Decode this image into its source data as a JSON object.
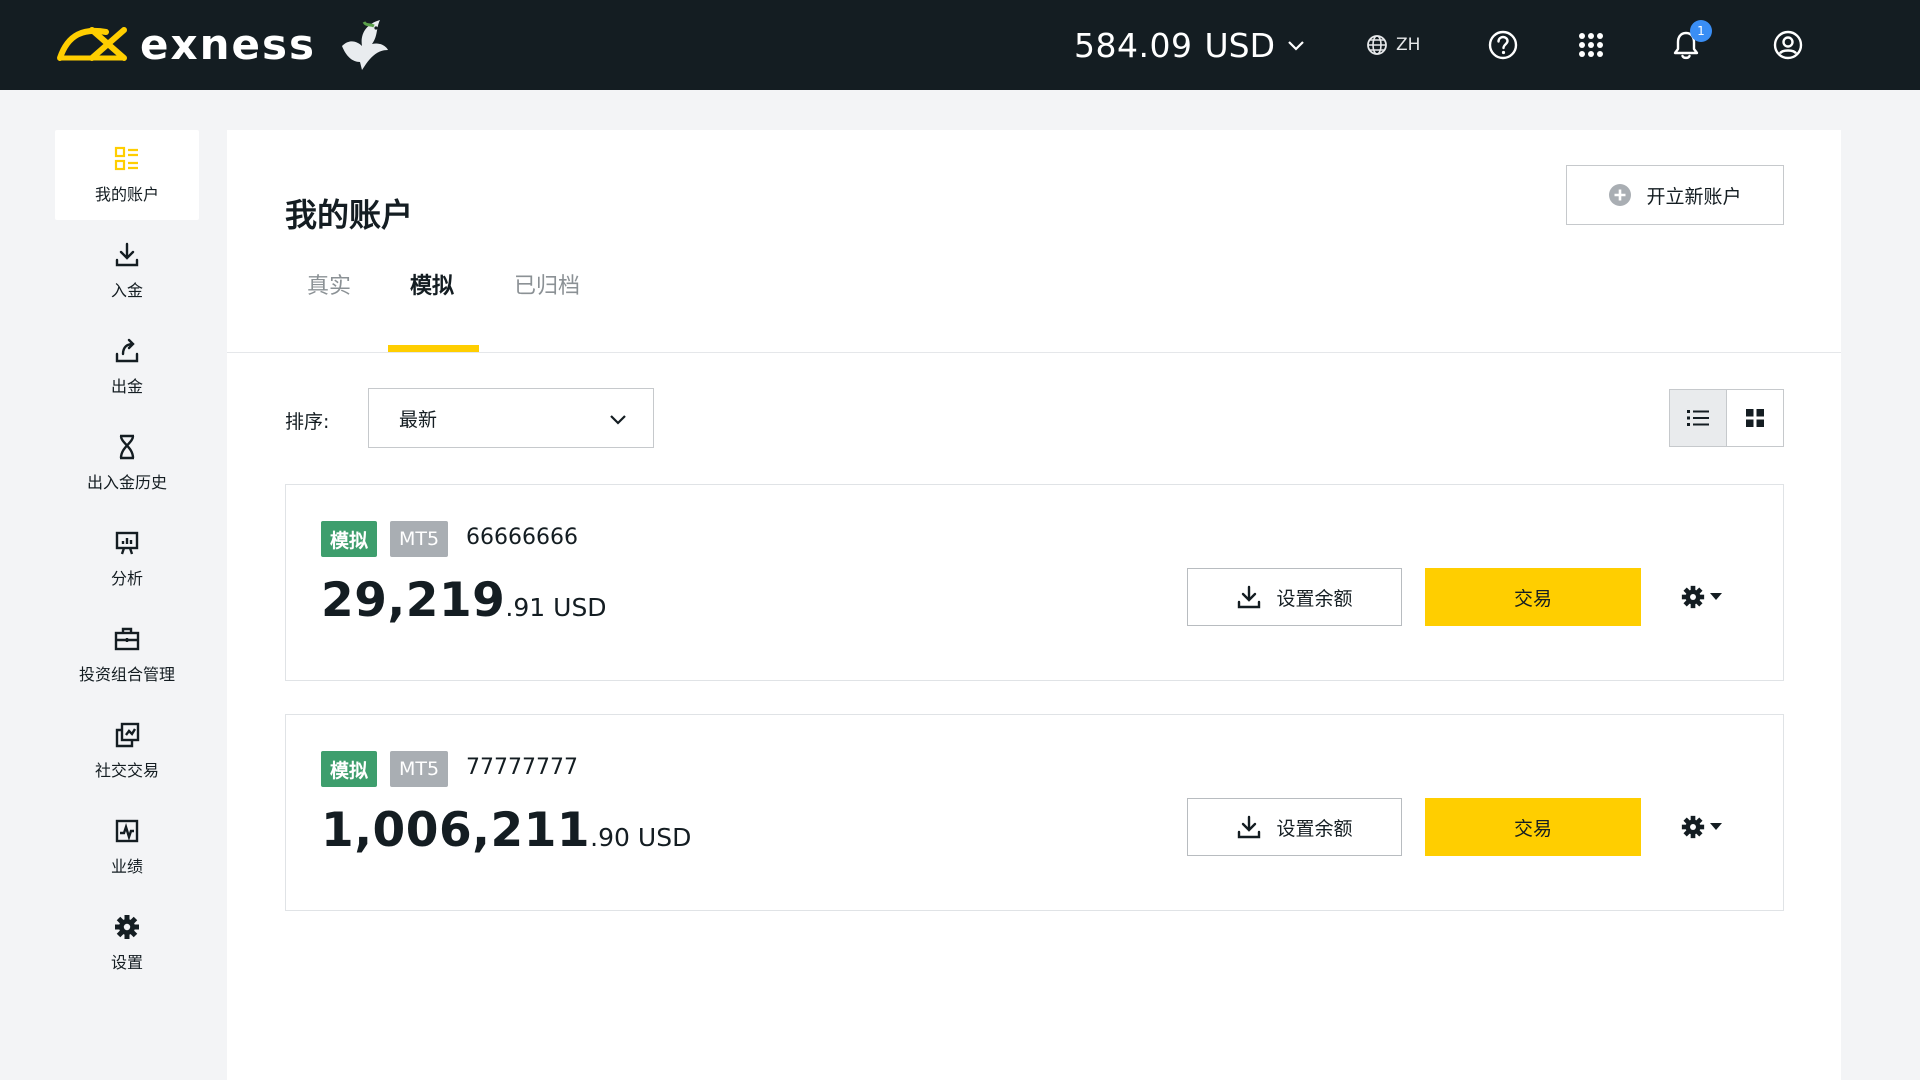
{
  "header": {
    "brand": "exness",
    "balance_amount": "584.09",
    "balance_currency": "USD",
    "language": "ZH",
    "notification_count": "1",
    "icons": [
      "help-icon",
      "apps-grid-icon",
      "bell-icon",
      "user-icon"
    ]
  },
  "sidebar": {
    "items": [
      {
        "label": "我的账户",
        "icon": "accounts-icon",
        "active": true
      },
      {
        "label": "入金",
        "icon": "deposit-icon"
      },
      {
        "label": "出金",
        "icon": "withdraw-icon"
      },
      {
        "label": "出入金历史",
        "icon": "hourglass-icon"
      },
      {
        "label": "分析",
        "icon": "analytics-icon"
      },
      {
        "label": "投资组合管理",
        "icon": "briefcase-icon"
      },
      {
        "label": "社交交易",
        "icon": "social-trading-icon"
      },
      {
        "label": "业绩",
        "icon": "performance-icon"
      },
      {
        "label": "设置",
        "icon": "gear-icon"
      }
    ]
  },
  "main": {
    "title": "我的账户",
    "open_account_label": "开立新账户",
    "tabs": [
      {
        "label": "真实"
      },
      {
        "label": "模拟",
        "active": true
      },
      {
        "label": "已归档"
      }
    ],
    "sort_label": "排序:",
    "sort_value": "最新",
    "accounts": [
      {
        "type_tag": "模拟",
        "platform_tag": "MT5",
        "number": "66666666",
        "balance_int": "29,219",
        "balance_dec": ".91",
        "currency": "USD",
        "set_balance_label": "设置余额",
        "trade_label": "交易"
      },
      {
        "type_tag": "模拟",
        "platform_tag": "MT5",
        "number": "77777777",
        "balance_int": "1,006,211",
        "balance_dec": ".90",
        "currency": "USD",
        "set_balance_label": "设置余额",
        "trade_label": "交易"
      }
    ]
  },
  "colors": {
    "header_bg": "#141d22",
    "accent_yellow": "#ffce00",
    "demo_tag_green": "#3e9e6d",
    "platform_tag_gray": "#a9aeb3",
    "notification_blue": "#3a8ef5"
  }
}
